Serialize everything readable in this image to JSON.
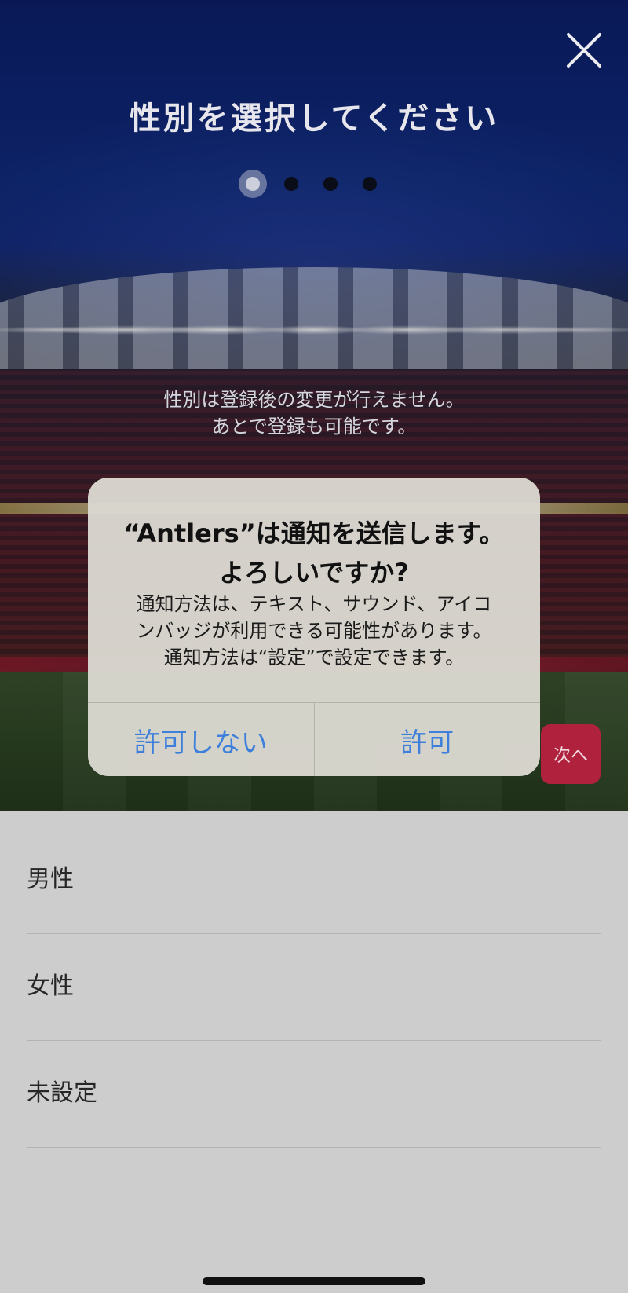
{
  "header": {
    "title": "性別を選択してください",
    "close_icon": "close-icon",
    "pager": {
      "total": 4,
      "current": 1
    }
  },
  "notice": {
    "line1": "性別は登録後の変更が行えません。",
    "line2": "あとで登録も可能です。"
  },
  "next_button": {
    "label": "次へ",
    "color": "#b0213e"
  },
  "alert": {
    "title_line1": "“Antlers”は通知を送信します。",
    "title_line2": "よろしいですか?",
    "message_line1": "通知方法は、テキスト、サウンド、アイコ",
    "message_line2": "ンバッジが利用できる可能性があります。",
    "message_line3": "通知方法は“設定”で設定できます。",
    "deny_label": "許可しない",
    "allow_label": "許可",
    "button_color": "#3d7fdb"
  },
  "options": [
    {
      "label": "男性"
    },
    {
      "label": "女性"
    },
    {
      "label": "未設定"
    }
  ]
}
